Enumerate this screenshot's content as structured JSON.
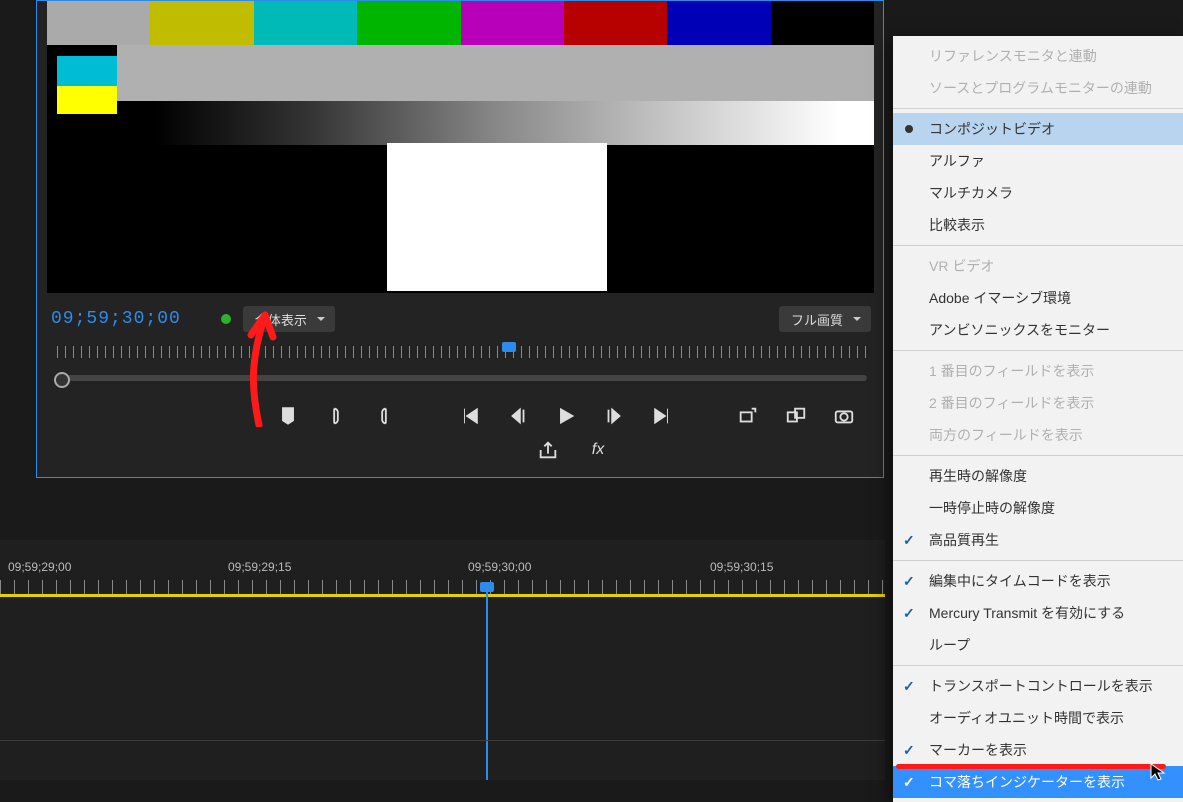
{
  "monitor": {
    "timecode": "09;59;30;00",
    "zoom_select": "全体表示",
    "quality_select": "フル画質"
  },
  "timeline": {
    "labels": [
      "09;59;29;00",
      "09;59;29;15",
      "09;59;30;00",
      "09;59;30;15"
    ]
  },
  "menu": {
    "items": [
      {
        "label": "リファレンスモニタと連動",
        "disabled": true
      },
      {
        "label": "ソースとプログラムモニターの連動",
        "disabled": true
      },
      {
        "sep": true
      },
      {
        "label": "コンポジットビデオ",
        "radio": true,
        "selected": true
      },
      {
        "label": "アルファ"
      },
      {
        "label": "マルチカメラ"
      },
      {
        "label": "比較表示"
      },
      {
        "sep": true
      },
      {
        "label": "VR ビデオ",
        "disabled": true
      },
      {
        "label": "Adobe イマーシブ環境"
      },
      {
        "label": "アンビソニックスをモニター"
      },
      {
        "sep": true
      },
      {
        "label": "1 番目のフィールドを表示",
        "disabled": true
      },
      {
        "label": "2 番目のフィールドを表示",
        "disabled": true
      },
      {
        "label": "両方のフィールドを表示",
        "disabled": true
      },
      {
        "sep": true
      },
      {
        "label": "再生時の解像度"
      },
      {
        "label": "一時停止時の解像度"
      },
      {
        "label": "高品質再生",
        "check": true
      },
      {
        "sep": true
      },
      {
        "label": "編集中にタイムコードを表示",
        "check": true
      },
      {
        "label": "Mercury Transmit を有効にする",
        "check": true
      },
      {
        "label": "ループ"
      },
      {
        "sep": true
      },
      {
        "label": "トランスポートコントロールを表示",
        "check": true
      },
      {
        "label": "オーディオユニット時間で表示"
      },
      {
        "label": "マーカーを表示",
        "check": true
      },
      {
        "label": "コマ落ちインジケーターを表示",
        "check": true,
        "highlight": true
      }
    ]
  }
}
